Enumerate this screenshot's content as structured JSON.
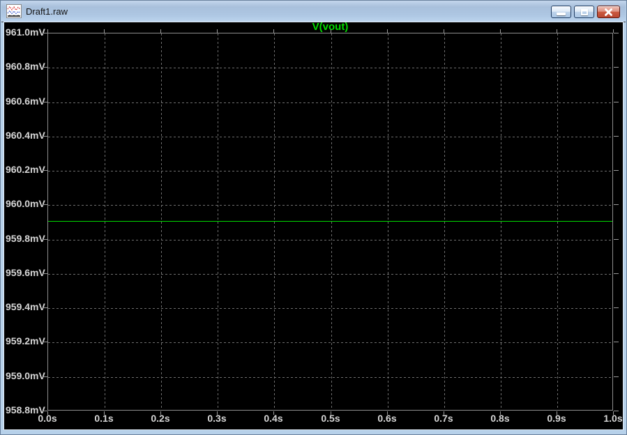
{
  "window": {
    "title": "Draft1.raw",
    "icon": "waveform-file-icon",
    "controls": [
      "minimize",
      "restore",
      "close"
    ]
  },
  "chart_data": {
    "type": "line",
    "title": "V(vout)",
    "legend": [
      {
        "label": "V(vout)",
        "color": "#00dc00"
      }
    ],
    "legend_position": "top-center",
    "grid": true,
    "background": "#000000",
    "x_ticks": [
      "0.0s",
      "0.1s",
      "0.2s",
      "0.3s",
      "0.4s",
      "0.5s",
      "0.6s",
      "0.7s",
      "0.8s",
      "0.9s",
      "1.0s"
    ],
    "y_ticks": [
      "961.0mV",
      "960.8mV",
      "960.6mV",
      "960.4mV",
      "960.2mV",
      "960.0mV",
      "959.8mV",
      "959.6mV",
      "959.4mV",
      "959.2mV",
      "959.0mV",
      "958.8mV"
    ],
    "xlim_s": [
      0.0,
      1.0
    ],
    "ylim_mV": [
      958.8,
      961.0
    ],
    "series": [
      {
        "name": "V(vout)",
        "color": "#00dc00",
        "x_s": [
          0.0,
          1.0
        ],
        "values_mV": [
          959.91,
          959.91
        ]
      }
    ]
  },
  "colors": {
    "trace_green": "#00dc00",
    "plot_background": "#000000",
    "grid_gray": "#6f6f6f",
    "axis_border_gray": "#8e8e8e",
    "tick_label_gray": "#d6d6d6",
    "titlebar_blue": "#aec7e3",
    "close_button_red": "#c95a40"
  }
}
